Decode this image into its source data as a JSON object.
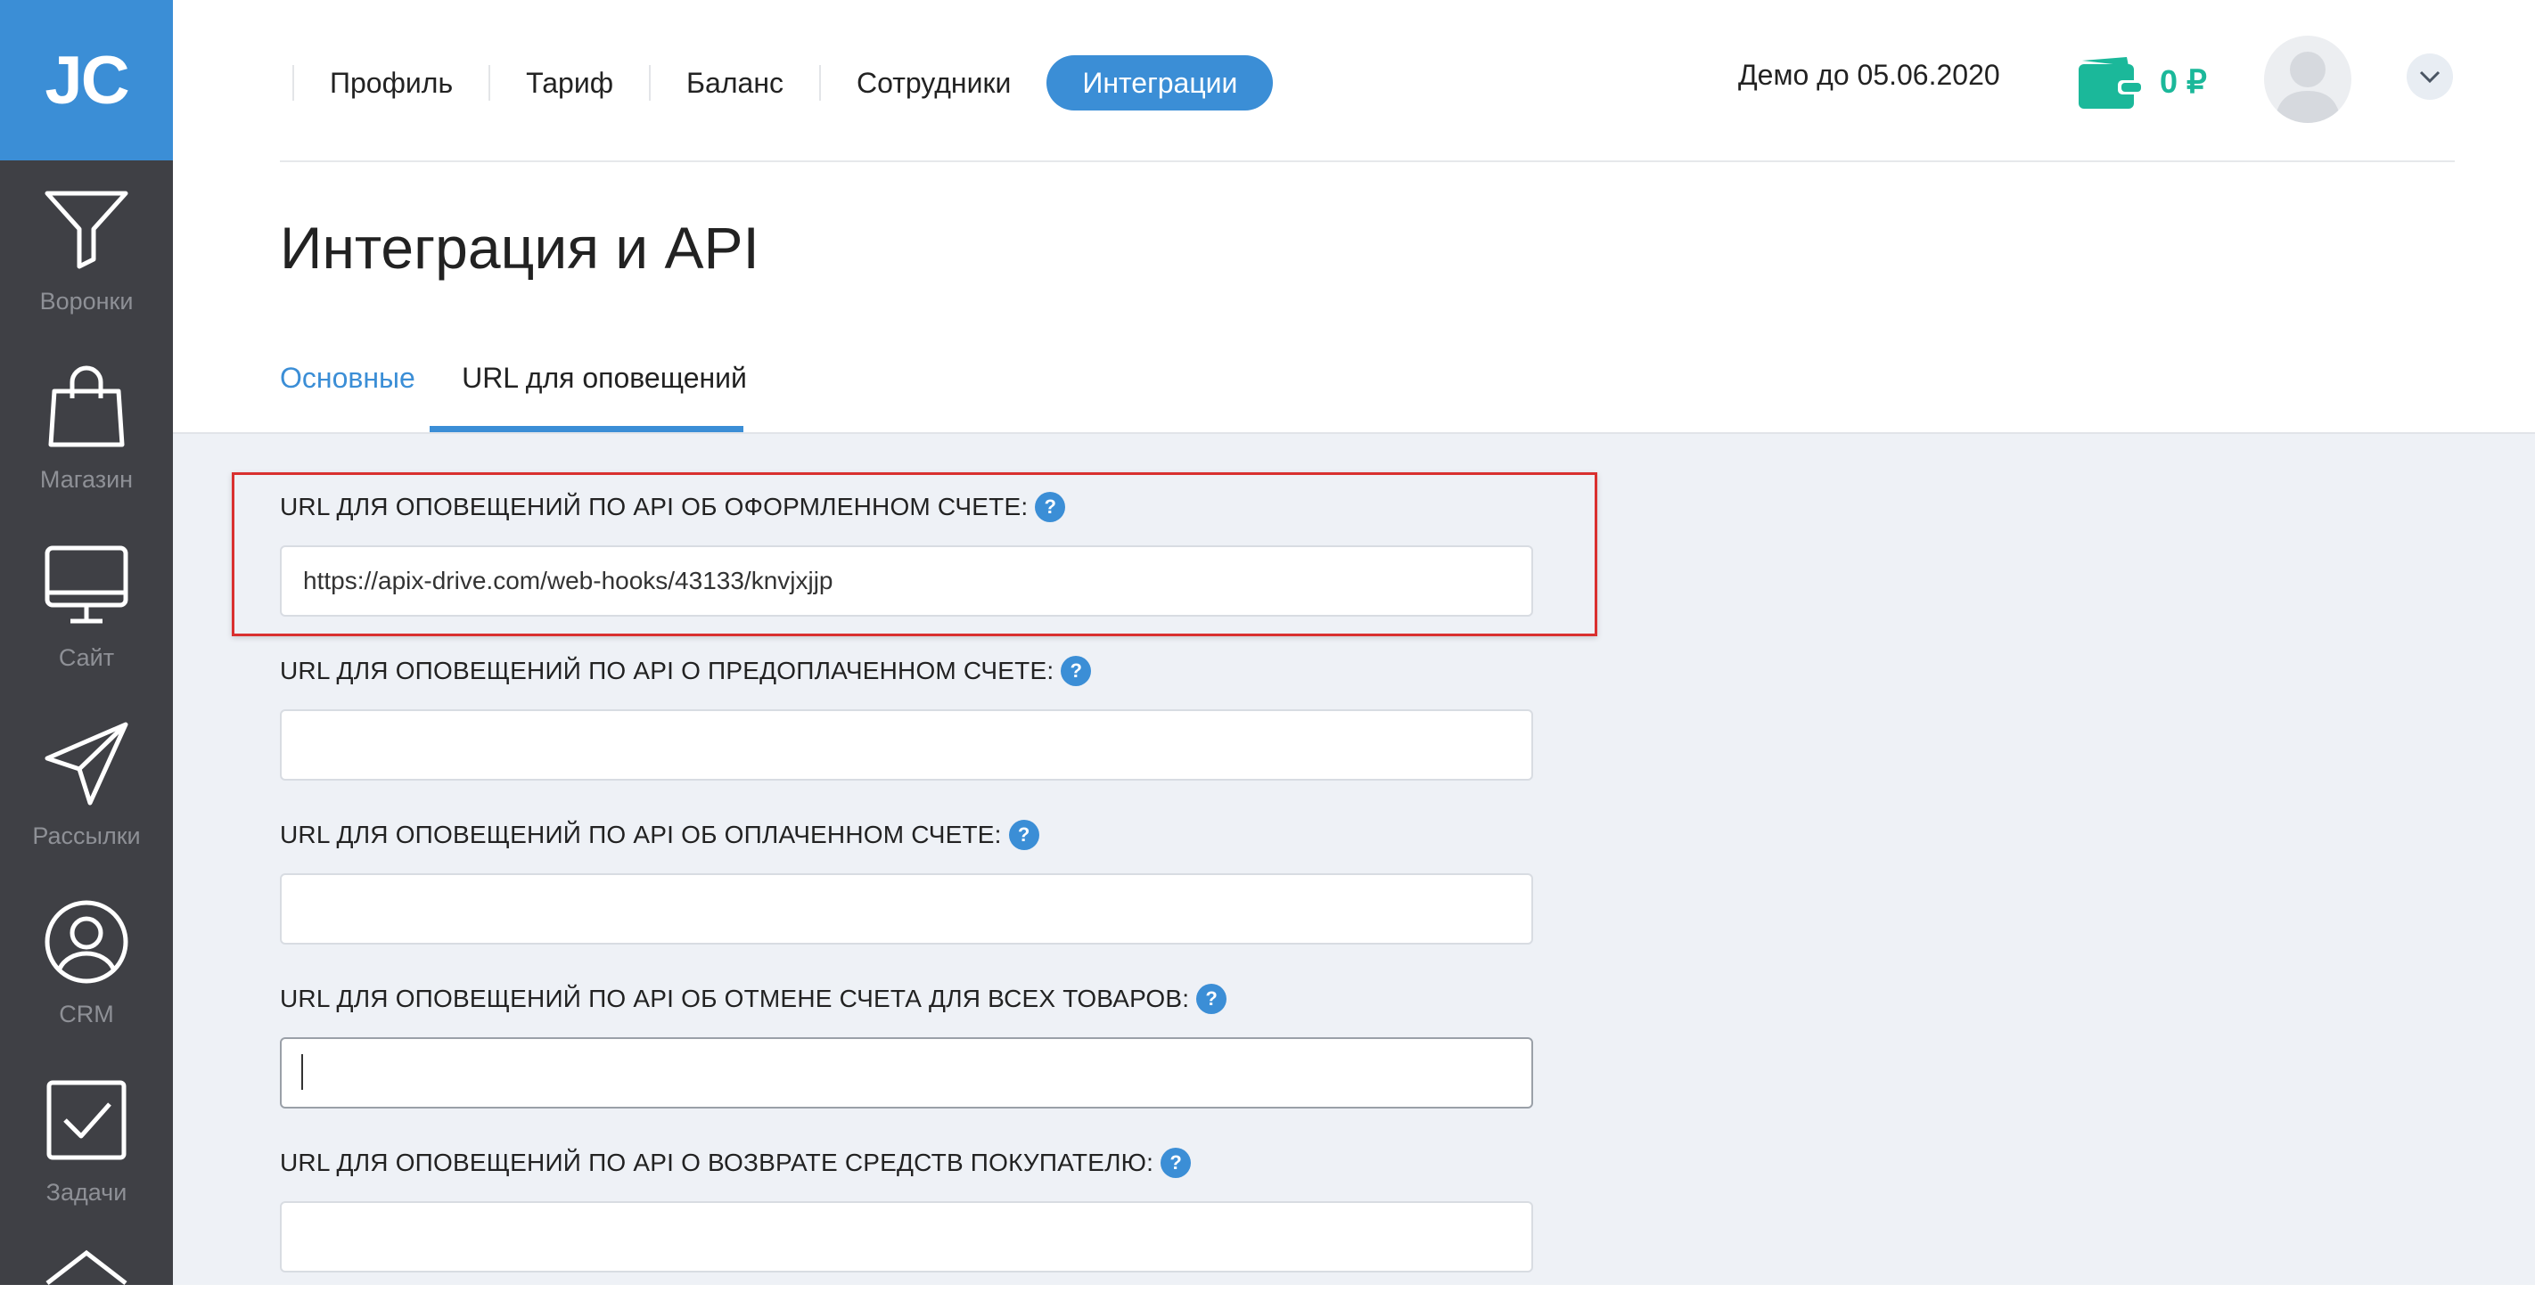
{
  "sidebar": {
    "logo": "JC",
    "items": [
      {
        "label": "Воронки",
        "icon": "funnel-icon"
      },
      {
        "label": "Магазин",
        "icon": "shopping-bag-icon"
      },
      {
        "label": "Сайт",
        "icon": "monitor-icon"
      },
      {
        "label": "Рассылки",
        "icon": "paper-plane-icon"
      },
      {
        "label": "CRM",
        "icon": "user-circle-icon"
      },
      {
        "label": "Задачи",
        "icon": "checkbox-icon"
      }
    ]
  },
  "header": {
    "tabs": [
      {
        "label": "Профиль",
        "active": false
      },
      {
        "label": "Тариф",
        "active": false
      },
      {
        "label": "Баланс",
        "active": false
      },
      {
        "label": "Сотрудники",
        "active": false
      },
      {
        "label": "Интеграции",
        "active": true
      }
    ],
    "demo": "Демо до 05.06.2020",
    "balance": "0 ₽"
  },
  "page": {
    "title": "Интеграция и API",
    "subtabs": [
      {
        "label": "Основные",
        "active": false
      },
      {
        "label": "URL для оповещений",
        "active": true
      }
    ]
  },
  "fields": [
    {
      "label": "URL ДЛЯ ОПОВЕЩЕНИЙ ПО API ОБ ОФОРМЛЕННОМ СЧЕТЕ:",
      "value": "https://apix-drive.com/web-hooks/43133/knvjxjjp"
    },
    {
      "label": "URL ДЛЯ ОПОВЕЩЕНИЙ ПО API О ПРЕДОПЛАЧЕННОМ СЧЕТЕ:",
      "value": ""
    },
    {
      "label": "URL ДЛЯ ОПОВЕЩЕНИЙ ПО API ОБ ОПЛАЧЕННОМ СЧЕТЕ:",
      "value": ""
    },
    {
      "label": "URL ДЛЯ ОПОВЕЩЕНИЙ ПО API ОБ ОТМЕНЕ СЧЕТА ДЛЯ ВСЕХ ТОВАРОВ:",
      "value": ""
    },
    {
      "label": "URL ДЛЯ ОПОВЕЩЕНИЙ ПО API О ВОЗВРАТЕ СРЕДСТВ ПОКУПАТЕЛЮ:",
      "value": ""
    }
  ],
  "help_glyph": "?",
  "colors": {
    "accent": "#3b8ed6",
    "sidebar": "#3f4045",
    "balance": "#1bb89a",
    "highlight": "#d9302f"
  }
}
